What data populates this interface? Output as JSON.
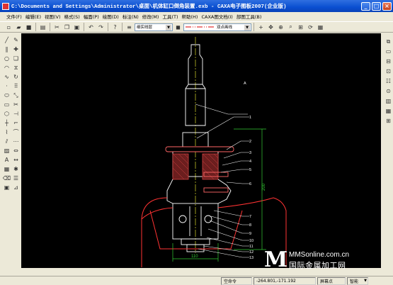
{
  "window": {
    "title": "C:\\Documents and Settings\\Administrator\\桌面\\机体缸口倒角装置.exb - CAXA电子图板2007(企业版)",
    "minimize": "_",
    "maximize": "□",
    "close": "×"
  },
  "menu": [
    "文件(F)",
    "编辑(E)",
    "视图(V)",
    "格式(S)",
    "幅面(P)",
    "绘图(D)",
    "标注(N)",
    "修改(M)",
    "工具(T)",
    "帮助(H)",
    "CAXA图文档(I)",
    "部图工具(B)"
  ],
  "toolbar": {
    "layer_combo": "细实线层",
    "linetype_combo": "双点画线"
  },
  "drawing": {
    "balloons": [
      "1",
      "2",
      "3",
      "4",
      "5",
      "6",
      "7",
      "8",
      "9",
      "10",
      "11",
      "12",
      "13"
    ],
    "top_label": "A",
    "dim_vertical": "200",
    "dim_horizontal": "110"
  },
  "status": {
    "command_label": "空命令",
    "coordinates": "-264.801,-171.192",
    "mode_label": "屏幕点",
    "snap_combo": "智能"
  },
  "watermark": {
    "logo_letter": "M",
    "site": "MMSonline.com.cn",
    "slogan": "国际金属加工网"
  },
  "colors": {
    "canvas": "#000000",
    "outline": "#ffffff",
    "contour": "#ff3333",
    "dimension": "#33cc33",
    "centerline": "#ffff33",
    "hatch": "#b04040"
  }
}
